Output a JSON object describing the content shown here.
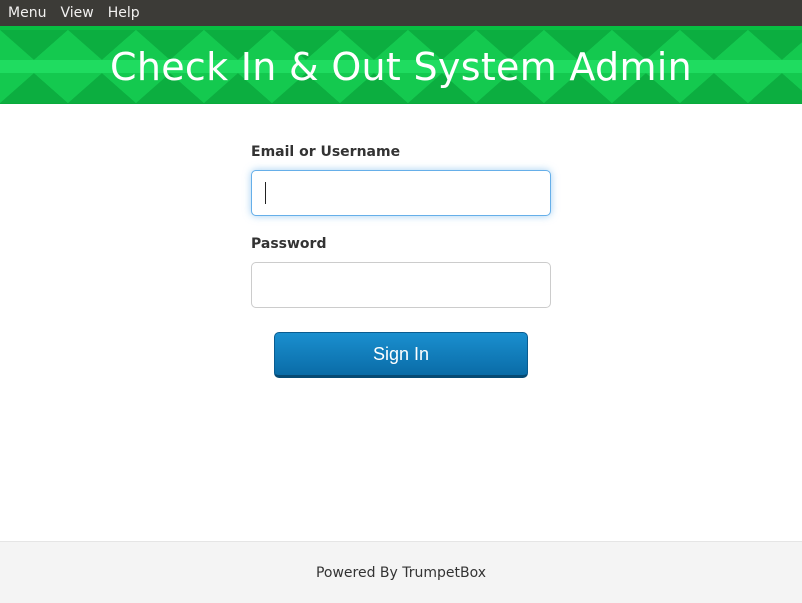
{
  "menubar": {
    "items": [
      "Menu",
      "View",
      "Help"
    ]
  },
  "banner": {
    "title": "Check In & Out System Admin"
  },
  "form": {
    "email_label": "Email or Username",
    "email_value": "",
    "password_label": "Password",
    "password_value": "",
    "signin_label": "Sign In"
  },
  "footer": {
    "text": "Powered By TrumpetBox"
  },
  "colors": {
    "banner_base": "#1fdc60",
    "banner_dark": "#0cae40",
    "banner_mid": "#14c94f",
    "accent_button": "#127fb8"
  }
}
